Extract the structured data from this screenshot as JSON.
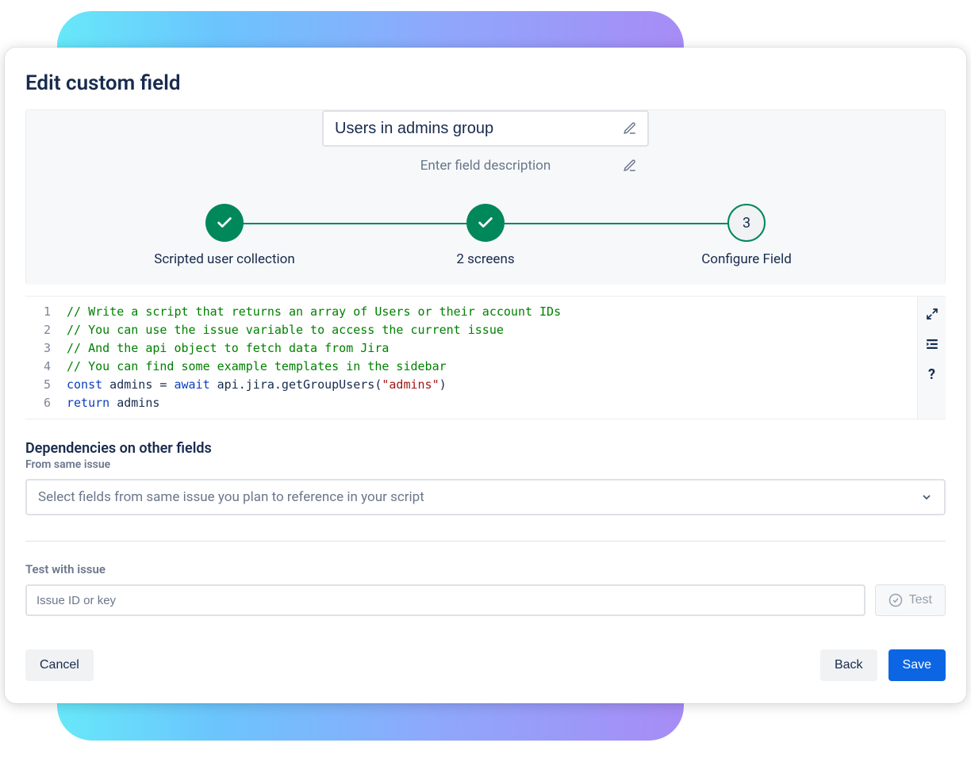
{
  "modal": {
    "title": "Edit custom field",
    "fieldName": "Users in admins group",
    "descriptionPlaceholder": "Enter field description"
  },
  "stepper": {
    "steps": [
      {
        "label": "Scripted user collection",
        "state": "done"
      },
      {
        "label": "2 screens",
        "state": "done"
      },
      {
        "label": "Configure Field",
        "state": "current",
        "number": "3"
      }
    ]
  },
  "editor": {
    "lines": [
      {
        "type": "comment",
        "text": "// Write a script that returns an array of Users or their account IDs"
      },
      {
        "type": "comment",
        "text": "// You can use the issue variable to access the current issue"
      },
      {
        "type": "comment",
        "text": "// And the api object to fetch data from Jira"
      },
      {
        "type": "comment",
        "text": "// You can find some example templates in the sidebar"
      },
      {
        "type": "code",
        "tokens": [
          {
            "t": "kw",
            "v": "const"
          },
          {
            "t": "p",
            "v": " admins = "
          },
          {
            "t": "kw",
            "v": "await"
          },
          {
            "t": "p",
            "v": " api.jira.getGroupUsers("
          },
          {
            "t": "str",
            "v": "\"admins\""
          },
          {
            "t": "p",
            "v": ")"
          }
        ]
      },
      {
        "type": "code",
        "tokens": [
          {
            "t": "kw",
            "v": "return"
          },
          {
            "t": "p",
            "v": " admins"
          }
        ]
      }
    ]
  },
  "dependencies": {
    "heading": "Dependencies on other fields",
    "sub": "From same issue",
    "selectPlaceholder": "Select fields from same issue you plan to reference in your script"
  },
  "test": {
    "heading": "Test with issue",
    "inputPlaceholder": "Issue ID or key",
    "buttonLabel": "Test"
  },
  "footer": {
    "cancel": "Cancel",
    "back": "Back",
    "save": "Save"
  }
}
